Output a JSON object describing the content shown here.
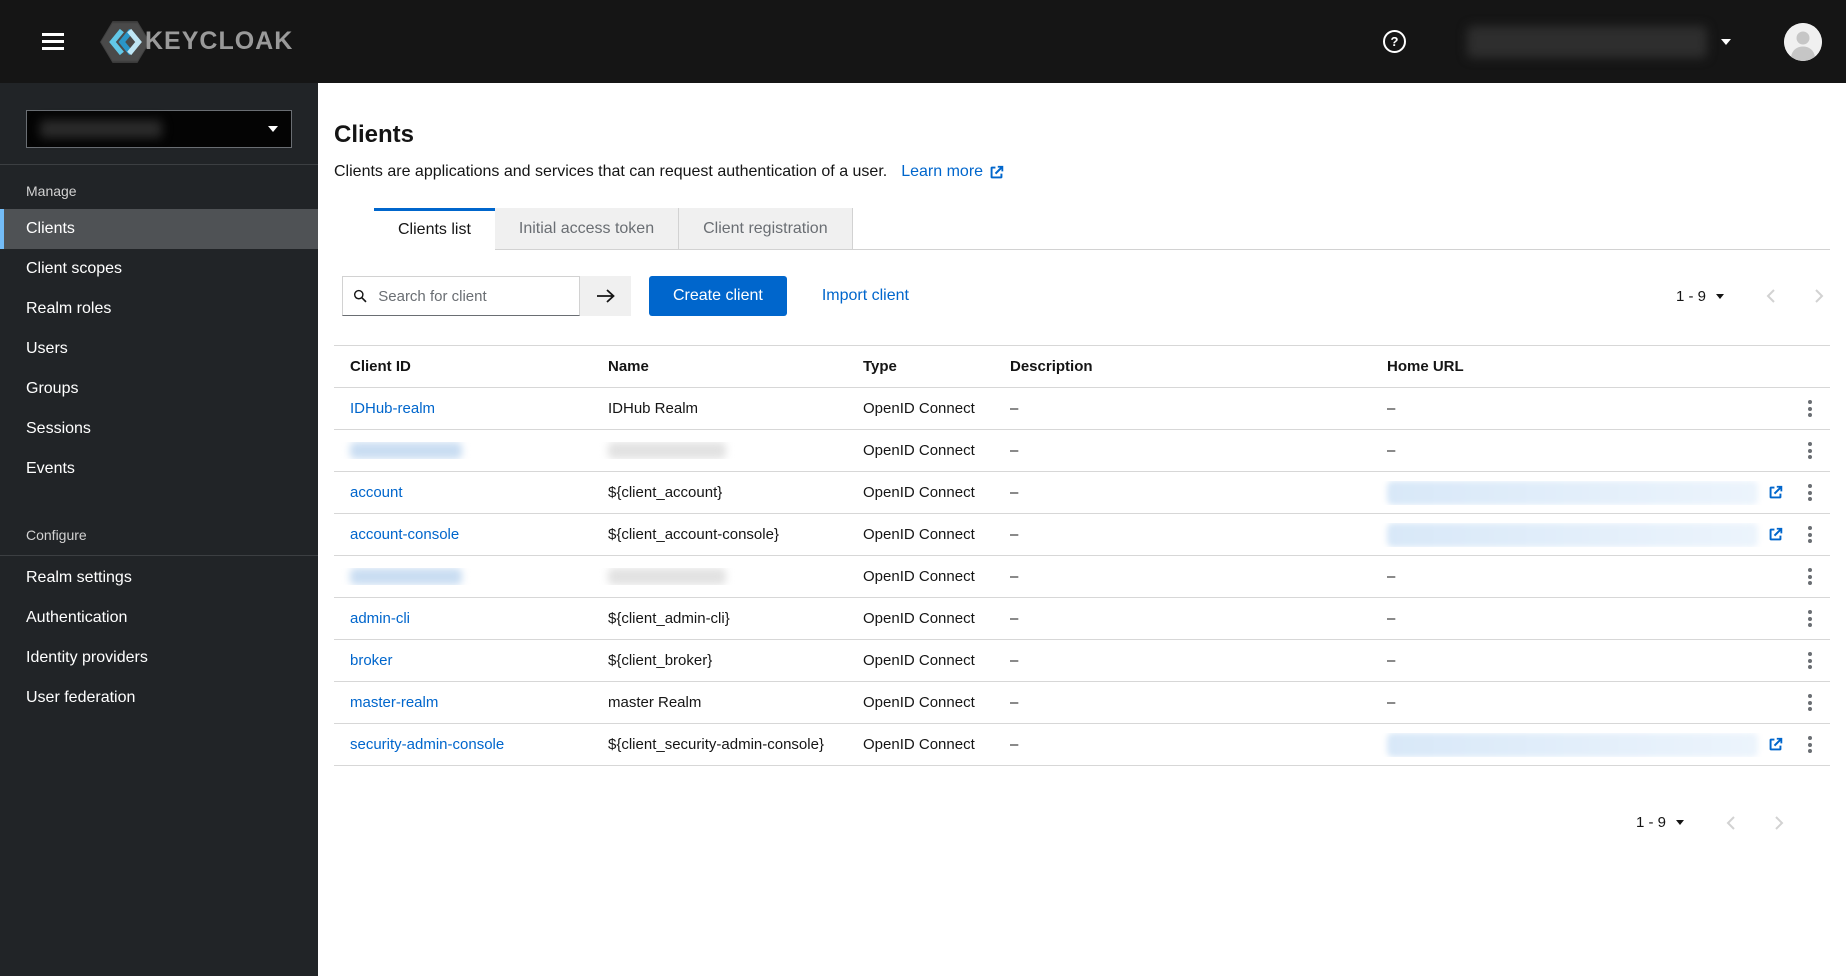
{
  "masthead": {
    "brand_text": "KEYCLOAK",
    "help_glyph": "?"
  },
  "sidebar": {
    "sections": [
      {
        "label": "Manage",
        "divider_below_label": false,
        "items": [
          {
            "label": "Clients",
            "active": true
          },
          {
            "label": "Client scopes",
            "active": false
          },
          {
            "label": "Realm roles",
            "active": false
          },
          {
            "label": "Users",
            "active": false
          },
          {
            "label": "Groups",
            "active": false
          },
          {
            "label": "Sessions",
            "active": false
          },
          {
            "label": "Events",
            "active": false
          }
        ]
      },
      {
        "label": "Configure",
        "divider_below_label": true,
        "items": [
          {
            "label": "Realm settings",
            "active": false
          },
          {
            "label": "Authentication",
            "active": false
          },
          {
            "label": "Identity providers",
            "active": false
          },
          {
            "label": "User federation",
            "active": false
          }
        ]
      }
    ]
  },
  "page": {
    "title": "Clients",
    "description": "Clients are applications and services that can request authentication of a user.",
    "learn_more_label": "Learn more",
    "tabs": [
      {
        "label": "Clients list",
        "active": true
      },
      {
        "label": "Initial access token",
        "active": false
      },
      {
        "label": "Client registration",
        "active": false
      }
    ]
  },
  "toolbar": {
    "search_placeholder": "Search for client",
    "create_button_label": "Create client",
    "import_link_label": "Import client",
    "pagination_label": "1 - 9"
  },
  "table": {
    "columns": [
      "Client ID",
      "Name",
      "Type",
      "Description",
      "Home URL"
    ],
    "empty_value": "–",
    "rows": [
      {
        "client_id": "IDHub-realm",
        "name": "IDHub Realm",
        "type": "OpenID Connect",
        "description": "–",
        "home_url": "–"
      },
      {
        "client_id_redacted": true,
        "name_redacted": true,
        "type": "OpenID Connect",
        "description": "–",
        "home_url": "–"
      },
      {
        "client_id": "account",
        "name": "${client_account}",
        "type": "OpenID Connect",
        "description": "–",
        "home_url_redacted": true,
        "home_url_external": true
      },
      {
        "client_id": "account-console",
        "name": "${client_account-console}",
        "type": "OpenID Connect",
        "description": "–",
        "home_url_redacted": true,
        "home_url_external": true
      },
      {
        "client_id_redacted": true,
        "name_redacted": true,
        "type": "OpenID Connect",
        "description": "–",
        "home_url": "–"
      },
      {
        "client_id": "admin-cli",
        "name": "${client_admin-cli}",
        "type": "OpenID Connect",
        "description": "–",
        "home_url": "–"
      },
      {
        "client_id": "broker",
        "name": "${client_broker}",
        "type": "OpenID Connect",
        "description": "–",
        "home_url": "–"
      },
      {
        "client_id": "master-realm",
        "name": "master Realm",
        "type": "OpenID Connect",
        "description": "–",
        "home_url": "–"
      },
      {
        "client_id": "security-admin-console",
        "name": "${client_security-admin-console}",
        "type": "OpenID Connect",
        "description": "–",
        "home_url_redacted": true,
        "home_url_external": true
      }
    ]
  },
  "pagination_bottom": {
    "label": "1 - 9"
  },
  "colors": {
    "accent_blue": "#0066cc",
    "masthead_bg": "#151515",
    "sidebar_bg": "#212427",
    "sidebar_active_bg": "#4f5255",
    "sidebar_active_accent": "#73bcf7",
    "tab_inactive_bg": "#f0f0f0",
    "keycloak_icon_blue": "#4cb3e0",
    "disabled_gray": "#d2d2d2"
  }
}
